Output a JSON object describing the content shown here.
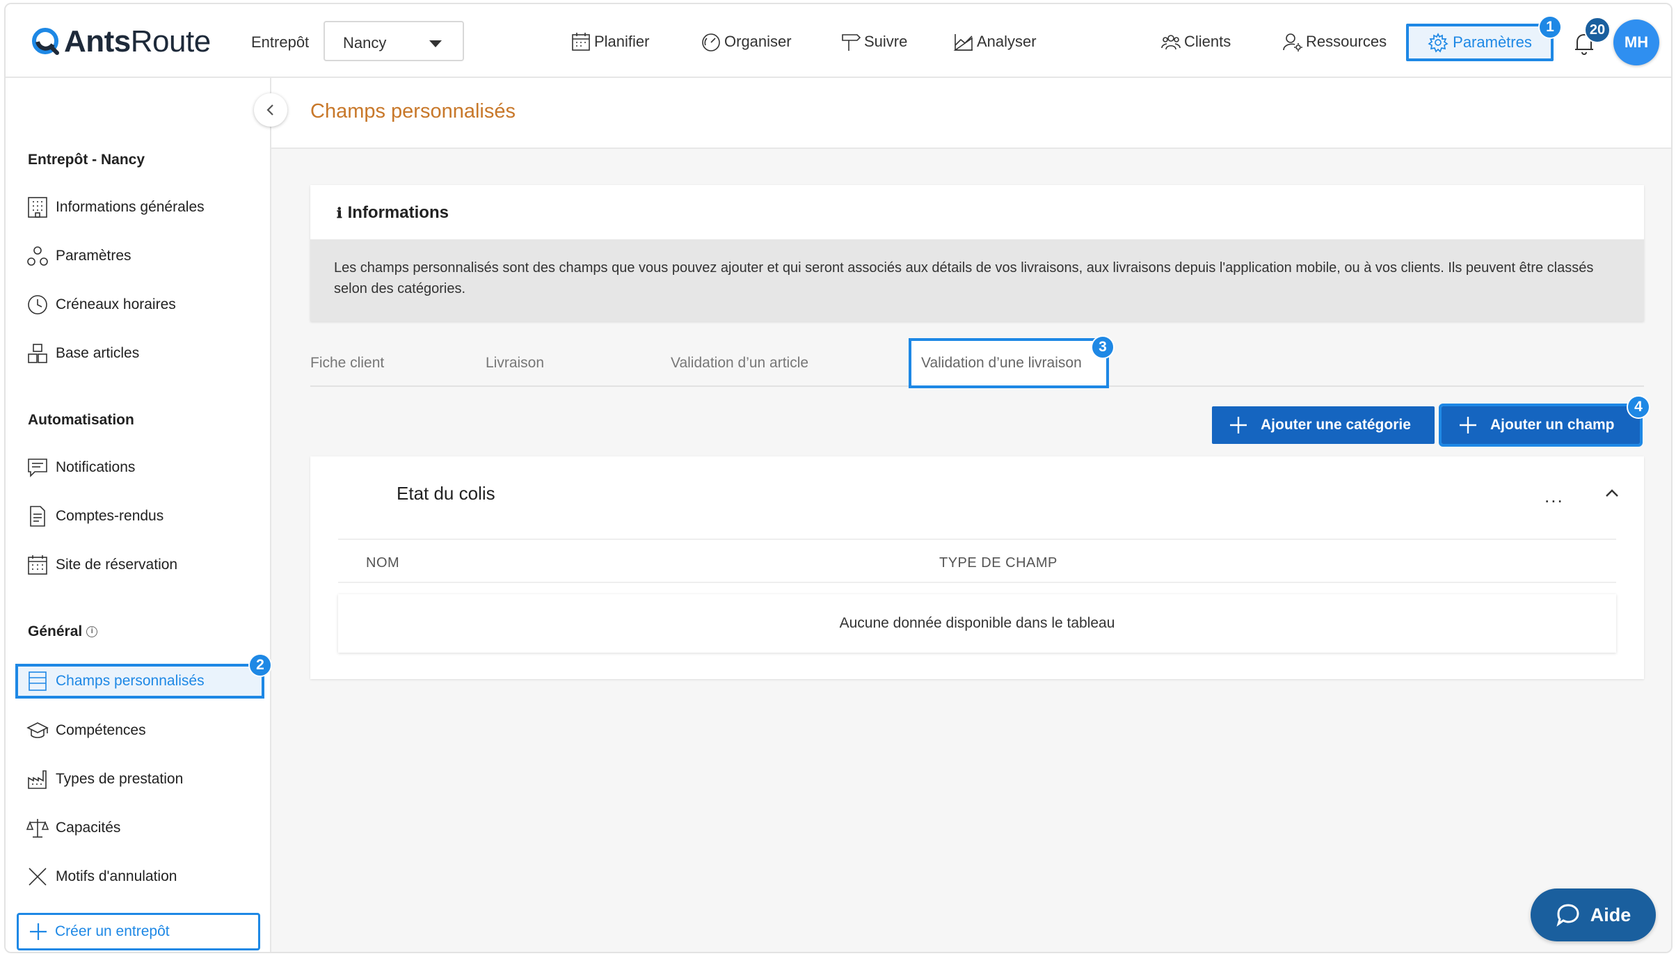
{
  "app": {
    "logo_bold": "Ants",
    "logo_light": "Route"
  },
  "header": {
    "warehouse_label": "Entrepôt",
    "warehouse_value": "Nancy",
    "nav": [
      {
        "label": "Planifier",
        "icon": "calendar-icon"
      },
      {
        "label": "Organiser",
        "icon": "gauge-icon"
      },
      {
        "label": "Suivre",
        "icon": "signpost-icon"
      },
      {
        "label": "Analyser",
        "icon": "chart-icon"
      }
    ],
    "clients_label": "Clients",
    "resources_label": "Ressources",
    "settings_label": "Paramètres",
    "notifications_count": "20",
    "avatar_initials": "MH"
  },
  "markers": {
    "m1": "1",
    "m2": "2",
    "m3": "3",
    "m4": "4"
  },
  "sidebar": {
    "section_warehouse": "Entrepôt - Nancy",
    "items_warehouse": [
      {
        "label": "Informations générales"
      },
      {
        "label": "Paramètres"
      },
      {
        "label": "Créneaux horaires"
      },
      {
        "label": "Base articles"
      }
    ],
    "section_automation": "Automatisation",
    "items_automation": [
      {
        "label": "Notifications"
      },
      {
        "label": "Comptes-rendus"
      },
      {
        "label": "Site de réservation"
      }
    ],
    "section_general": "Général",
    "items_general": [
      {
        "label": "Champs personnalisés"
      },
      {
        "label": "Compétences"
      },
      {
        "label": "Types de prestation"
      },
      {
        "label": "Capacités"
      },
      {
        "label": "Motifs d'annulation"
      }
    ],
    "create_label": "Créer un entrepôt"
  },
  "main": {
    "page_title": "Champs personnalisés",
    "info_title": "Informations",
    "info_text": "Les champs personnalisés sont des champs que vous pouvez ajouter et qui seront associés aux détails de vos livraisons, aux livraisons depuis l'application mobile, ou à vos clients. Ils peuvent être classés selon des catégories.",
    "tabs": [
      {
        "label": "Fiche client"
      },
      {
        "label": "Livraison"
      },
      {
        "label": "Validation d’un article"
      },
      {
        "label": "Validation d’une livraison"
      }
    ],
    "btn_add_category": "Ajouter une catégorie",
    "btn_add_field": "Ajouter un champ",
    "category": {
      "title": "Etat du colis",
      "menu": "...",
      "columns": [
        "NOM",
        "TYPE DE CHAMP"
      ],
      "empty_text": "Aucune donnée disponible dans le tableau"
    },
    "help_label": "Aide"
  },
  "colors": {
    "accent": "#1e88e5",
    "primary": "#1565c0",
    "title": "#c8782a"
  }
}
